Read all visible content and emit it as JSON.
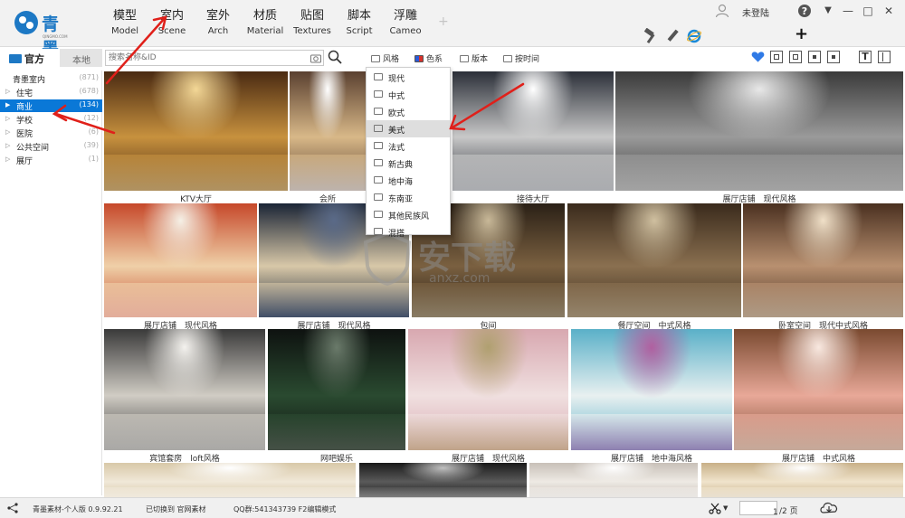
{
  "app": {
    "logo": "青墨",
    "logo_sub": "QINGMO.COM"
  },
  "tabs": [
    {
      "zh": "模型",
      "en": "Model"
    },
    {
      "zh": "室内",
      "en": "Scene"
    },
    {
      "zh": "室外",
      "en": "Arch"
    },
    {
      "zh": "材质",
      "en": "Material"
    },
    {
      "zh": "贴图",
      "en": "Textures"
    },
    {
      "zh": "脚本",
      "en": "Script"
    },
    {
      "zh": "浮雕",
      "en": "Cameo"
    }
  ],
  "tab_add": "+",
  "user": {
    "login_label": "未登陆"
  },
  "window": {
    "help": "?",
    "menu": "▼",
    "min": "—",
    "max": "□",
    "close": "✕"
  },
  "toolbar": {
    "plus": "+",
    "icons": [
      "hammer-icon",
      "pencil-icon",
      "ie-icon"
    ]
  },
  "sidebar": {
    "tab_official": "官方",
    "tab_local": "本地",
    "items": [
      {
        "label": "青墨室内",
        "count": "(871)"
      },
      {
        "label": "住宅",
        "count": "(678)"
      },
      {
        "label": "商业",
        "count": "(134)"
      },
      {
        "label": "学校",
        "count": "(12)"
      },
      {
        "label": "医院",
        "count": "(6)"
      },
      {
        "label": "公共空间",
        "count": "(39)"
      },
      {
        "label": "展厅",
        "count": "(1)"
      }
    ]
  },
  "search": {
    "placeholder": "搜索名称&ID"
  },
  "filters": [
    "风格",
    "色系",
    "版本",
    "按时间"
  ],
  "style_dropdown": {
    "items": [
      "现代",
      "中式",
      "欧式",
      "美式",
      "法式",
      "新古典",
      "地中海",
      "东南亚",
      "其他民族风",
      "混搭"
    ],
    "highlighted": "美式"
  },
  "gallery": [
    {
      "caption": "KTV大厅",
      "palette": [
        "#4a2a12",
        "#c7913e",
        "#f3d796"
      ]
    },
    {
      "caption": "会所",
      "palette": [
        "#5a4030",
        "#d8b888",
        "#ffffff"
      ]
    },
    {
      "caption": "接待大厅",
      "palette": [
        "#2b2f38",
        "#c8c8c8",
        "#ffffff"
      ]
    },
    {
      "caption": "展厅店铺　现代风格",
      "palette": [
        "#3a3a3a",
        "#9a9a9a",
        "#e8e8e8"
      ]
    },
    {
      "caption": "展厅店铺　现代风格",
      "palette": [
        "#c6482a",
        "#efd0a8",
        "#f5f0e6"
      ]
    },
    {
      "caption": "展厅店铺　现代风格",
      "palette": [
        "#1a2435",
        "#d8c8a8",
        "#5a6a88"
      ]
    },
    {
      "caption": "包间",
      "palette": [
        "#2a2016",
        "#7a6040",
        "#c8b898"
      ]
    },
    {
      "caption": "餐厅空间　中式风格",
      "palette": [
        "#3a2a1c",
        "#8a7050",
        "#d0c0a0"
      ]
    },
    {
      "caption": "卧室空间　现代中式风格",
      "palette": [
        "#4a3020",
        "#b89070",
        "#f0e0c8"
      ]
    },
    {
      "caption": "宾馆套房　loft风格",
      "palette": [
        "#3a3a3a",
        "#d0ccc4",
        "#f4f2ee"
      ]
    },
    {
      "caption": "网吧娱乐",
      "palette": [
        "#0e1210",
        "#2a4a30",
        "#6a7a6a"
      ]
    },
    {
      "caption": "展厅店铺　现代风格",
      "palette": [
        "#d8a8b0",
        "#f0e0e0",
        "#b0a070"
      ]
    },
    {
      "caption": "展厅店铺　地中海风格",
      "palette": [
        "#5ab0c8",
        "#e8f0f0",
        "#b060a0"
      ]
    },
    {
      "caption": "展厅店铺　中式风格",
      "palette": [
        "#7a4a30",
        "#e8a898",
        "#f8e8e0"
      ]
    },
    {
      "caption": "",
      "palette": [
        "#d8c8a8",
        "#f0e8d8",
        "#ffffff"
      ]
    },
    {
      "caption": "",
      "palette": [
        "#1a1a1a",
        "#5a5a5a",
        "#c0c0c0"
      ]
    },
    {
      "caption": "",
      "palette": [
        "#c8c0b8",
        "#eeeae4",
        "#ffffff"
      ]
    },
    {
      "caption": "",
      "palette": [
        "#3a3026",
        "#a08868",
        "#e8dcc8"
      ]
    },
    {
      "caption": "",
      "palette": [
        "#c8b088",
        "#f0e4cc",
        "#ffffff"
      ]
    }
  ],
  "status": {
    "version": "青墨素材-个人版 0.9.92.21",
    "source": "已切换到 官网素材",
    "qq": "QQ群:541343739 F2编辑模式",
    "page_current": "1",
    "page_total": "/2 页"
  },
  "watermark": {
    "text": "安下载",
    "sub": "anxz.com"
  },
  "accent": "#0a78d7",
  "annotation_color": "#e0201a"
}
